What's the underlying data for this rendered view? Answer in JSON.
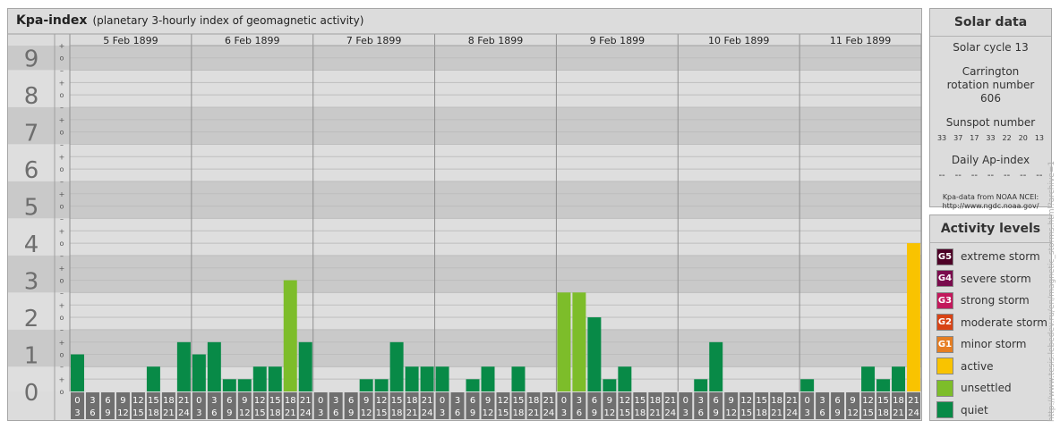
{
  "title": {
    "main": "Kpa-index",
    "subtitle": "(planetary 3-hourly index of geomagnetic activity)"
  },
  "solar": {
    "header": "Solar data",
    "cycle": "Solar cycle 13",
    "carrington": "Carrington rotation number 606",
    "sunspot_label": "Sunspot number",
    "sunspots": [
      "33",
      "37",
      "17",
      "33",
      "22",
      "20",
      "13"
    ],
    "ap_label": "Daily Ap-index",
    "ap_values": [
      "--",
      "--",
      "--",
      "--",
      "--",
      "--",
      "--"
    ],
    "source_line1": "Kpa-data from NOAA NCEI:",
    "source_line2": "http://www.ngdc.noaa.gov/"
  },
  "activity": {
    "header": "Activity levels",
    "levels": [
      {
        "badge": "G5",
        "label": "extreme storm",
        "color": "#4d0026"
      },
      {
        "badge": "G4",
        "label": "severe storm",
        "color": "#7a0b4d"
      },
      {
        "badge": "G3",
        "label": "strong storm",
        "color": "#c2185b"
      },
      {
        "badge": "G2",
        "label": "moderate storm",
        "color": "#d84315"
      },
      {
        "badge": "G1",
        "label": "minor storm",
        "color": "#e67e22"
      },
      {
        "badge": "",
        "label": "active",
        "color": "#f9c300"
      },
      {
        "badge": "",
        "label": "unsettled",
        "color": "#7dbd2a"
      },
      {
        "badge": "",
        "label": "quiet",
        "color": "#088a47"
      }
    ]
  },
  "credit": "http://www.tesis.lebedev.ru/en/magnetic_storms.html?archive=1",
  "chart_data": {
    "type": "bar",
    "days": [
      "5 Feb 1899",
      "6 Feb 1899",
      "7 Feb 1899",
      "8 Feb 1899",
      "9 Feb 1899",
      "10 Feb 1899",
      "11 Feb 1899"
    ],
    "hour_start": [
      "0",
      "3",
      "6",
      "9",
      "12",
      "15",
      "18",
      "21"
    ],
    "hour_end": [
      "3",
      "6",
      "9",
      "12",
      "15",
      "18",
      "21",
      "24"
    ],
    "y_ticks": [
      "0",
      "1",
      "2",
      "3",
      "4",
      "5",
      "6",
      "7",
      "8",
      "9"
    ],
    "ylim": [
      0,
      9.33
    ],
    "values": [
      [
        1.0,
        0,
        0,
        0,
        0,
        0.67,
        0,
        1.33
      ],
      [
        1.0,
        1.33,
        0.33,
        0.33,
        0.67,
        0.67,
        3.0,
        1.33
      ],
      [
        0,
        0,
        0,
        0.33,
        0.33,
        1.33,
        0.67,
        0.67
      ],
      [
        0.67,
        0,
        0.33,
        0.67,
        0,
        0.67,
        0,
        0
      ],
      [
        2.67,
        2.67,
        2.0,
        0.33,
        0.67,
        0,
        0,
        0
      ],
      [
        0,
        0.33,
        1.33,
        0,
        0,
        0,
        0,
        0
      ],
      [
        0.33,
        0,
        0,
        0,
        0.67,
        0.33,
        0.67,
        4.0
      ]
    ],
    "level_colors": {
      "quiet": "#088a47",
      "unsettled": "#7dbd2a",
      "active": "#f9c300"
    }
  }
}
